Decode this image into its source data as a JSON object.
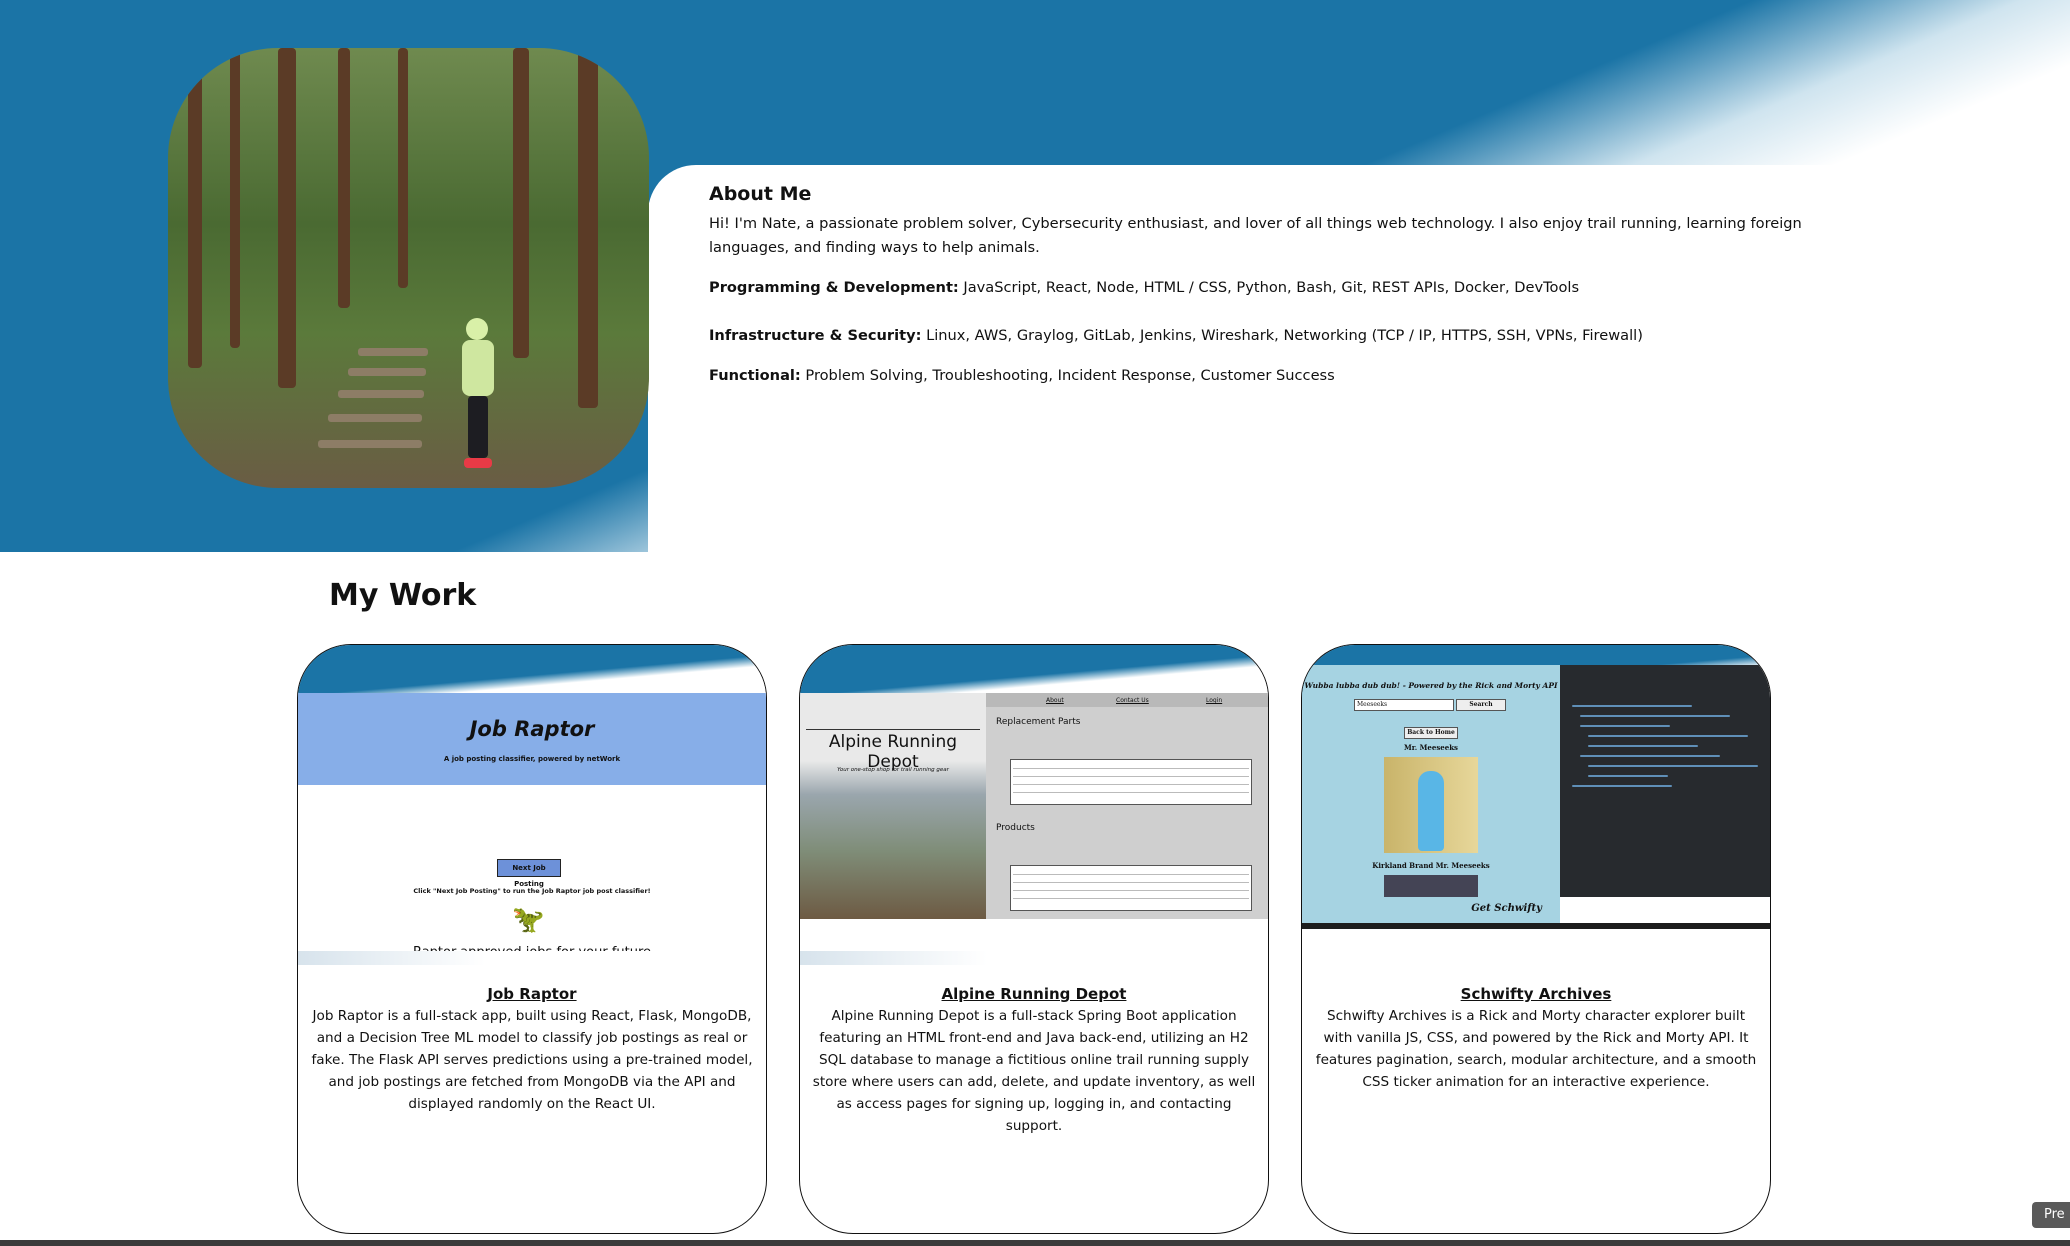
{
  "about": {
    "heading": "About Me",
    "intro": "Hi! I'm Nate, a passionate problem solver, Cybersecurity enthusiast, and lover of all things web technology. I also enjoy trail running, learning foreign languages, and finding ways to help animals.",
    "skills": [
      {
        "label": "Programming & Development:",
        "value": " JavaScript, React, Node, HTML / CSS, Python, Bash, Git, REST APIs, Docker, DevTools"
      },
      {
        "label": "Infrastructure & Security:",
        "value": " Linux, AWS, Graylog, GitLab, Jenkins, Wireshark, Networking (TCP / IP, HTTPS, SSH, VPNs, Firewall)"
      },
      {
        "label": "Functional:",
        "value": " Problem Solving, Troubleshooting, Incident Response, Customer Success"
      }
    ]
  },
  "work": {
    "title": "My Work",
    "projects": [
      {
        "title": "Job Raptor",
        "description": "Job Raptor is a full-stack app, built using React, Flask, MongoDB, and a Decision Tree ML model to classify job postings as real or fake. The Flask API serves predictions using a pre-trained model, and job postings are fetched from MongoDB via the API and displayed randomly on the React UI.",
        "screenshot": {
          "app_title": "Job Raptor",
          "subtitle": "A job posting classifier, powered by netWork",
          "button": "Next Job Posting",
          "hint": "Click \"Next Job Posting\" to run the Job Raptor job post classifier!",
          "tagline": "Raptor-approved jobs for your future",
          "icon": "dinosaur-icon"
        }
      },
      {
        "title": "Alpine Running Depot",
        "description": "Alpine Running Depot is a full-stack Spring Boot application featuring an HTML front-end and Java back-end, utilizing an H2 SQL database to manage a fictitious online trail running supply store where users can add, delete, and update inventory, as well as access pages for signing up, logging in, and contacting support.",
        "screenshot": {
          "app_title": "Alpine Running Depot",
          "subtitle": "Your one-stop shop for trail running gear",
          "nav": [
            "About",
            "Contact Us",
            "Login"
          ],
          "section1": "Replacement Parts",
          "section2": "Products"
        }
      },
      {
        "title": "Schwifty Archives",
        "description": "Schwifty Archives is a Rick and Morty character explorer built with vanilla JS, CSS, and powered by the Rick and Morty API. It features pagination, search, modular architecture, and a smooth CSS ticker animation for an interactive experience.",
        "screenshot": {
          "header": "Wubba lubba dub dub! - Powered by the Rick and Morty API",
          "search_value": "Meeseeks",
          "search_button": "Search",
          "back_button": "Back to Home",
          "char1": "Mr. Meeseeks",
          "char2": "Kirkland Brand Mr. Meeseeks",
          "ticker": "Get Schwifty"
        }
      }
    ]
  },
  "corner_button": "Pre",
  "colors": {
    "accent": "#1b74a6",
    "raptor": "#87aee8",
    "schwifty": "#a6d3e2"
  }
}
